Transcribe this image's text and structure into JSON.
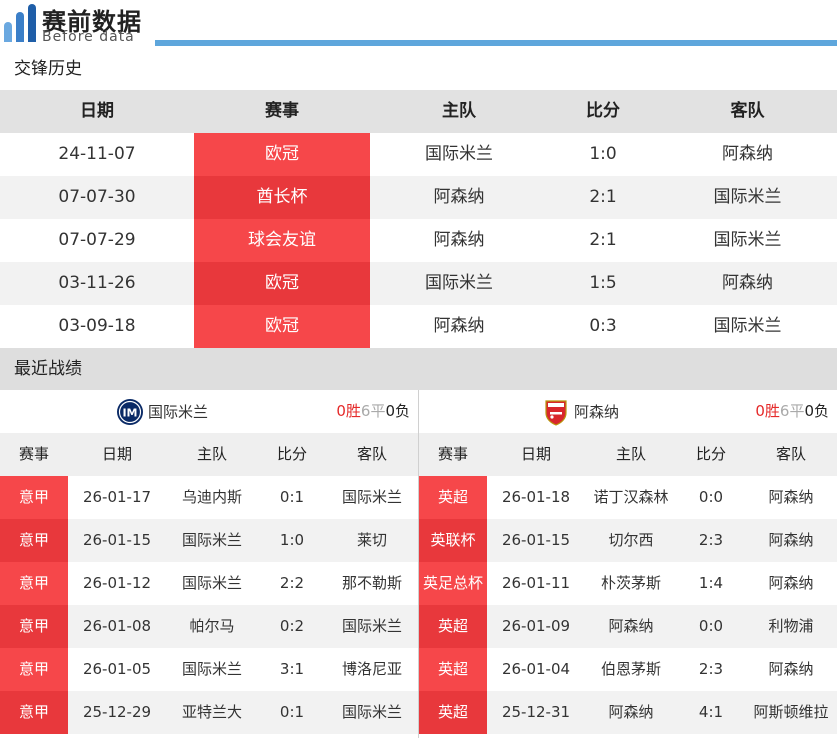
{
  "header": {
    "title": "赛前数据",
    "subtitle": "Before data"
  },
  "h2h": {
    "title": "交锋历史",
    "columns": [
      "日期",
      "赛事",
      "主队",
      "比分",
      "客队"
    ],
    "rows": [
      {
        "date": "24-11-07",
        "comp": "欧冠",
        "home": "国际米兰",
        "score": "1:0",
        "away": "阿森纳"
      },
      {
        "date": "07-07-30",
        "comp": "酋长杯",
        "home": "阿森纳",
        "score": "2:1",
        "away": "国际米兰"
      },
      {
        "date": "07-07-29",
        "comp": "球会友谊",
        "home": "阿森纳",
        "score": "2:1",
        "away": "国际米兰"
      },
      {
        "date": "03-11-26",
        "comp": "欧冠",
        "home": "国际米兰",
        "score": "1:5",
        "away": "阿森纳"
      },
      {
        "date": "03-09-18",
        "comp": "欧冠",
        "home": "阿森纳",
        "score": "0:3",
        "away": "国际米兰"
      }
    ]
  },
  "recent": {
    "title": "最近战绩",
    "columns": [
      "赛事",
      "日期",
      "主队",
      "比分",
      "客队"
    ],
    "left": {
      "team": "国际米兰",
      "badge": "inter-badge-icon",
      "wins": "0胜",
      "draws": "6平",
      "losses": "0负",
      "rows": [
        {
          "comp": "意甲",
          "date": "26-01-17",
          "home": "乌迪内斯",
          "score": "0:1",
          "away": "国际米兰"
        },
        {
          "comp": "意甲",
          "date": "26-01-15",
          "home": "国际米兰",
          "score": "1:0",
          "away": "莱切"
        },
        {
          "comp": "意甲",
          "date": "26-01-12",
          "home": "国际米兰",
          "score": "2:2",
          "away": "那不勒斯"
        },
        {
          "comp": "意甲",
          "date": "26-01-08",
          "home": "帕尔马",
          "score": "0:2",
          "away": "国际米兰"
        },
        {
          "comp": "意甲",
          "date": "26-01-05",
          "home": "国际米兰",
          "score": "3:1",
          "away": "博洛尼亚"
        },
        {
          "comp": "意甲",
          "date": "25-12-29",
          "home": "亚特兰大",
          "score": "0:1",
          "away": "国际米兰"
        }
      ]
    },
    "right": {
      "team": "阿森纳",
      "badge": "arsenal-badge-icon",
      "wins": "0胜",
      "draws": "6平",
      "losses": "0负",
      "rows": [
        {
          "comp": "英超",
          "date": "26-01-18",
          "home": "诺丁汉森林",
          "score": "0:0",
          "away": "阿森纳"
        },
        {
          "comp": "英联杯",
          "date": "26-01-15",
          "home": "切尔西",
          "score": "2:3",
          "away": "阿森纳"
        },
        {
          "comp": "英足总杯",
          "date": "26-01-11",
          "home": "朴茨茅斯",
          "score": "1:4",
          "away": "阿森纳"
        },
        {
          "comp": "英超",
          "date": "26-01-09",
          "home": "阿森纳",
          "score": "0:0",
          "away": "利物浦"
        },
        {
          "comp": "英超",
          "date": "26-01-04",
          "home": "伯恩茅斯",
          "score": "2:3",
          "away": "阿森纳"
        },
        {
          "comp": "英超",
          "date": "25-12-31",
          "home": "阿森纳",
          "score": "4:1",
          "away": "阿斯顿维拉"
        }
      ]
    }
  },
  "colors": {
    "accent_line": "#5ea6dc",
    "comp_red": "#f6474a",
    "comp_red_dark": "#e8383c",
    "win_red": "#e52a2a",
    "draw_gray": "#aaaaaa"
  }
}
